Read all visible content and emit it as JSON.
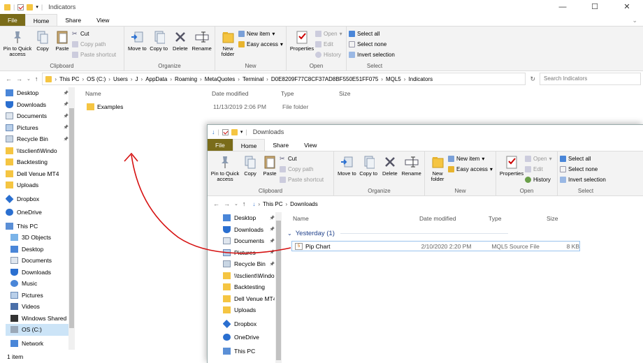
{
  "w1": {
    "title": "Indicators",
    "tabs": [
      "File",
      "Home",
      "Share",
      "View"
    ],
    "ribbon": {
      "pin_label": "Pin to Quick access",
      "copy": "Copy",
      "paste": "Paste",
      "cut": "Cut",
      "copy_path": "Copy path",
      "paste_shortcut": "Paste shortcut",
      "clipboard": "Clipboard",
      "move_to": "Move to",
      "copy_to": "Copy to",
      "delete": "Delete",
      "rename": "Rename",
      "organize": "Organize",
      "new_folder": "New folder",
      "new_item": "New item",
      "easy_access": "Easy access",
      "new": "New",
      "properties": "Properties",
      "open": "Open",
      "edit": "Edit",
      "history": "History",
      "open_group": "Open",
      "select_all": "Select all",
      "select_none": "Select none",
      "invert_selection": "Invert selection",
      "select": "Select"
    },
    "path": [
      "This PC",
      "OS (C:)",
      "Users",
      "J",
      "AppData",
      "Roaming",
      "MetaQuotes",
      "Terminal",
      "D0E8209F77C8CF37AD8BF550E51FF075",
      "MQL5",
      "Indicators"
    ],
    "search_placeholder": "Search Indicators",
    "nav": [
      "Desktop",
      "Downloads",
      "Documents",
      "Pictures",
      "Recycle Bin",
      "\\\\tsclient\\Windo",
      "Backtesting",
      "Dell Venue MT4",
      "Uploads",
      "Dropbox",
      "OneDrive",
      "This PC",
      "3D Objects",
      "Desktop",
      "Documents",
      "Downloads",
      "Music",
      "Pictures",
      "Videos",
      "Windows Shared",
      "OS (C:)",
      "Network"
    ],
    "columns": [
      "Name",
      "Date modified",
      "Type",
      "Size"
    ],
    "files": [
      {
        "name": "Examples",
        "date": "11/13/2019 2:06 PM",
        "type": "File folder",
        "size": ""
      }
    ],
    "status": "1 item"
  },
  "w2": {
    "title": "Downloads",
    "tabs": [
      "File",
      "Home",
      "Share",
      "View"
    ],
    "path": [
      "This PC",
      "Downloads"
    ],
    "nav": [
      "Desktop",
      "Downloads",
      "Documents",
      "Pictures",
      "Recycle Bin",
      "\\\\tsclient\\Windo",
      "Backtesting",
      "Dell Venue MT4",
      "Uploads",
      "Dropbox",
      "OneDrive",
      "This PC"
    ],
    "columns": [
      "Name",
      "Date modified",
      "Type",
      "Size"
    ],
    "group": "Yesterday (1)",
    "files": [
      {
        "name": "Pip Chart",
        "date": "2/10/2020 2:20 PM",
        "type": "MQL5 Source File",
        "size": "8 KB"
      }
    ]
  }
}
